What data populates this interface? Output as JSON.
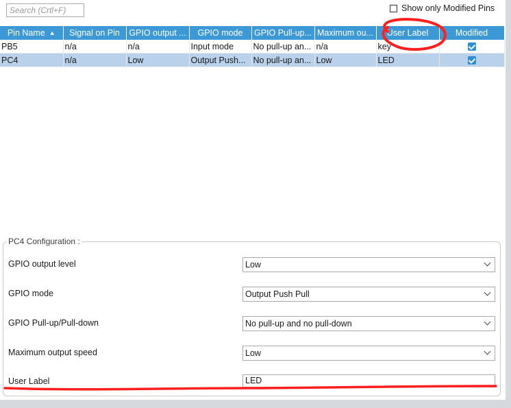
{
  "search": {
    "placeholder": "Search (Crtl+F)"
  },
  "show_only_modified": {
    "label": "Show only Modified Pins",
    "checked": false
  },
  "table": {
    "columns": [
      "Pin Name",
      "Signal on Pin",
      "GPIO output ...",
      "GPIO mode",
      "GPIO Pull-up...",
      "Maximum ou...",
      "User Label",
      "Modified"
    ],
    "rows": [
      {
        "pin": "PB5",
        "signal": "n/a",
        "output": "n/a",
        "mode": "Input mode",
        "pull": "No pull-up an...",
        "speed": "n/a",
        "label": "key",
        "modified": true
      },
      {
        "pin": "PC4",
        "signal": "n/a",
        "output": "Low",
        "mode": "Output Push...",
        "pull": "No pull-up an...",
        "speed": "Low",
        "label": "LED",
        "modified": true
      }
    ]
  },
  "config": {
    "title": "PC4 Configuration :",
    "fields": [
      {
        "label": "GPIO output level",
        "value": "Low"
      },
      {
        "label": "GPIO mode",
        "value": "Output Push Pull"
      },
      {
        "label": "GPIO Pull-up/Pull-down",
        "value": "No pull-up and no pull-down"
      },
      {
        "label": "Maximum output speed",
        "value": "Low"
      }
    ],
    "user_label": {
      "label": "User Label",
      "value": "LED"
    }
  },
  "colors": {
    "header": "#3d99d6",
    "selected_row": "#b9d1ea",
    "annotation": "#ff1f1f"
  }
}
